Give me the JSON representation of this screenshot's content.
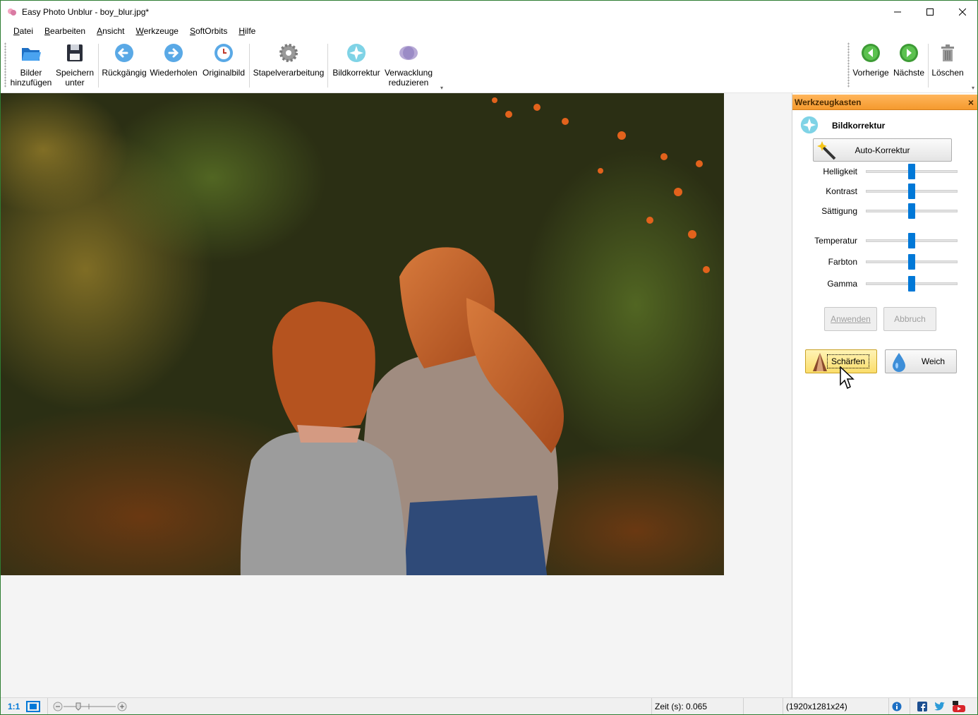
{
  "window": {
    "title": "Easy Photo Unblur - boy_blur.jpg*"
  },
  "menu": [
    "Datei",
    "Bearbeiten",
    "Ansicht",
    "Werkzeuge",
    "SoftOrbits",
    "Hilfe"
  ],
  "toolbar": {
    "add_images": "Bilder\nhinzufügen",
    "save_as": "Speichern\nunter",
    "undo": "Rückgängig",
    "redo": "Wiederholen",
    "original": "Originalbild",
    "batch": "Stapelverarbeitung",
    "correction": "Bildkorrektur",
    "deshake": "Verwacklung\nreduzieren",
    "previous": "Vorherige",
    "next": "Nächste",
    "delete": "Löschen"
  },
  "toolbox": {
    "title": "Werkzeugkasten",
    "section": "Bildkorrektur",
    "auto_button": "Auto-Korrektur",
    "sliders": [
      {
        "label": "Helligkeit",
        "value": 0.5
      },
      {
        "label": "Kontrast",
        "value": 0.5
      },
      {
        "label": "Sättigung",
        "value": 0.5
      },
      {
        "label": "Temperatur",
        "value": 0.5
      },
      {
        "label": "Farbton",
        "value": 0.5
      },
      {
        "label": "Gamma",
        "value": 0.5
      }
    ],
    "apply": "Anwenden",
    "cancel": "Abbruch",
    "sharpen": "Schärfen",
    "soft": "Weich"
  },
  "status": {
    "zoom_ratio": "1:1",
    "time": "Zeit (s): 0.065",
    "dimensions": "(1920x1281x24)"
  },
  "colors": {
    "accent": "#0078d7",
    "toolbox_header": "#f59a2e",
    "window_border": "#2e7d32"
  }
}
